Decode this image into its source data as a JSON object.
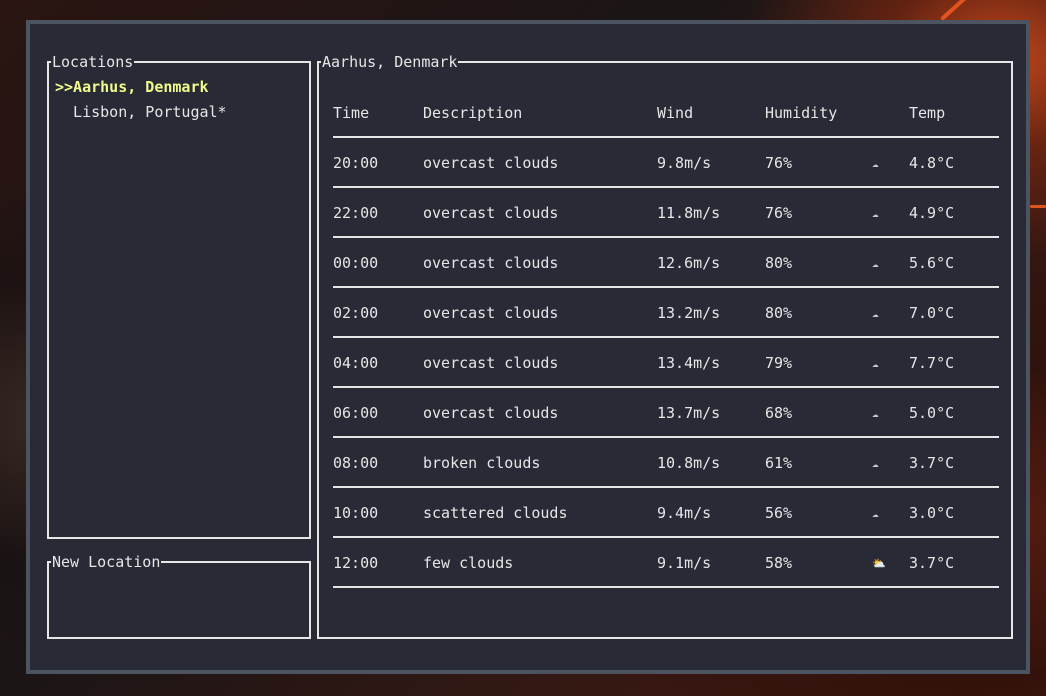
{
  "panels": {
    "locations_title": "Locations",
    "new_location_title": "New Location"
  },
  "locations": [
    {
      "label": ">>Aarhus, Denmark",
      "selected": true
    },
    {
      "label": "  Lisbon, Portugal*",
      "selected": false
    }
  ],
  "new_location": {
    "value": ""
  },
  "forecast": {
    "title": "Aarhus, Denmark",
    "headers": {
      "time": "Time",
      "description": "Description",
      "wind": "Wind",
      "humidity": "Humidity",
      "temp": "Temp"
    },
    "rows": [
      {
        "time": "20:00",
        "description": "overcast clouds",
        "wind": "9.8m/s",
        "humidity": "76%",
        "icon": "cloud-icon",
        "glyph": "☁",
        "temp": "4.8°C"
      },
      {
        "time": "22:00",
        "description": "overcast clouds",
        "wind": "11.8m/s",
        "humidity": "76%",
        "icon": "cloud-icon",
        "glyph": "☁",
        "temp": "4.9°C"
      },
      {
        "time": "00:00",
        "description": "overcast clouds",
        "wind": "12.6m/s",
        "humidity": "80%",
        "icon": "cloud-icon",
        "glyph": "☁",
        "temp": "5.6°C"
      },
      {
        "time": "02:00",
        "description": "overcast clouds",
        "wind": "13.2m/s",
        "humidity": "80%",
        "icon": "cloud-icon",
        "glyph": "☁",
        "temp": "7.0°C"
      },
      {
        "time": "04:00",
        "description": "overcast clouds",
        "wind": "13.4m/s",
        "humidity": "79%",
        "icon": "cloud-icon",
        "glyph": "☁",
        "temp": "7.7°C"
      },
      {
        "time": "06:00",
        "description": "overcast clouds",
        "wind": "13.7m/s",
        "humidity": "68%",
        "icon": "cloud-icon",
        "glyph": "☁",
        "temp": "5.0°C"
      },
      {
        "time": "08:00",
        "description": "broken clouds",
        "wind": "10.8m/s",
        "humidity": "61%",
        "icon": "cloud-icon",
        "glyph": "☁",
        "temp": "3.7°C"
      },
      {
        "time": "10:00",
        "description": "scattered clouds",
        "wind": "9.4m/s",
        "humidity": "56%",
        "icon": "cloud-icon",
        "glyph": "☁",
        "temp": "3.0°C"
      },
      {
        "time": "12:00",
        "description": "few clouds",
        "wind": "9.1m/s",
        "humidity": "58%",
        "icon": "sun-behind-cloud-icon",
        "glyph": "⛅",
        "temp": "3.7°C"
      }
    ]
  },
  "colors": {
    "selected": "#f1fa8c",
    "text": "#e6e6e6",
    "background": "#282a36",
    "cloud_icon": "#c8c8c8",
    "sun_icon": "#e6892a"
  }
}
